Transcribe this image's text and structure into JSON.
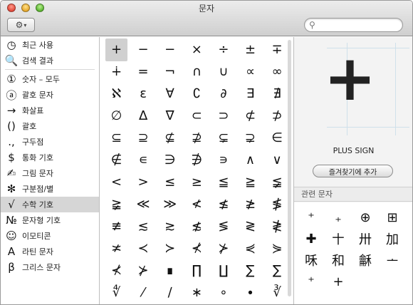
{
  "window": {
    "title": "문자"
  },
  "toolbar": {
    "gear_icon": "⚙",
    "caret": "▾",
    "search_icon": "⚲",
    "search_value": "",
    "search_placeholder": ""
  },
  "sidebar": {
    "items": [
      {
        "icon": "◷",
        "label": "최근 사용"
      },
      {
        "icon": "🔍",
        "label": "검색 결과"
      },
      {
        "icon": "①",
        "label": "숫자 – 모두"
      },
      {
        "icon": "ⓐ",
        "label": "괄호 문자"
      },
      {
        "icon": "→",
        "label": "화살표"
      },
      {
        "icon": "()",
        "label": "괄호"
      },
      {
        "icon": ".,",
        "label": "구두점"
      },
      {
        "icon": "$",
        "label": "통화 기호"
      },
      {
        "icon": "✍",
        "label": "그림 문자"
      },
      {
        "icon": "✻",
        "label": "구분점/별"
      },
      {
        "icon": "√",
        "label": "수학 기호"
      },
      {
        "icon": "№",
        "label": "문자형 기호"
      },
      {
        "icon": "☺",
        "label": "이모티콘"
      },
      {
        "icon": "A",
        "label": "라틴 문자"
      },
      {
        "icon": "β",
        "label": "그리스 문자"
      }
    ],
    "selected_label": "수학 기호"
  },
  "grid": {
    "rows": [
      [
        "+",
        "−",
        "−",
        "×",
        "÷",
        "±",
        "∓"
      ],
      [
        "∔",
        "=",
        "¬",
        "∩",
        "∪",
        "∝",
        "∞"
      ],
      [
        "ℵ",
        "ε",
        "∀",
        "∁",
        "∂",
        "∃",
        "∄"
      ],
      [
        "∅",
        "∆",
        "∇",
        "⊂",
        "⊃",
        "⊄",
        "⊅"
      ],
      [
        "⊆",
        "⊇",
        "⊈",
        "⊉",
        "⊊",
        "⊋",
        "∈"
      ],
      [
        "∉",
        "∊",
        "∋",
        "∌",
        "∍",
        "∧",
        "∨"
      ],
      [
        "<",
        ">",
        "≤",
        "≥",
        "≦",
        "≧",
        "≨"
      ],
      [
        "≩",
        "≪",
        "≫",
        "≮",
        "≰",
        "≱",
        "≸"
      ],
      [
        "≢",
        "≲",
        "≳",
        "≴",
        "≶",
        "≷",
        "≹"
      ],
      [
        "≭",
        "≺",
        "≻",
        "⊀",
        "⊁",
        "⋞",
        "⋟"
      ],
      [
        "⊀",
        "⊁",
        "∎",
        "∏",
        "∐",
        "∑",
        "∑"
      ],
      [
        "∜",
        "⁄",
        "∕",
        "∗",
        "∘",
        "∙",
        "∛"
      ]
    ],
    "selected_char": "+"
  },
  "preview": {
    "char": "+",
    "name": "PLUS SIGN",
    "fav_button": "즐겨찾기에 추가"
  },
  "related": {
    "header": "관련 문자",
    "chars": [
      "⁺",
      "₊",
      "⊕",
      "⊞",
      "✚",
      "〸",
      "卅",
      "加",
      "咊",
      "和",
      "龢",
      "ᅩ",
      "⁺",
      "+"
    ]
  }
}
